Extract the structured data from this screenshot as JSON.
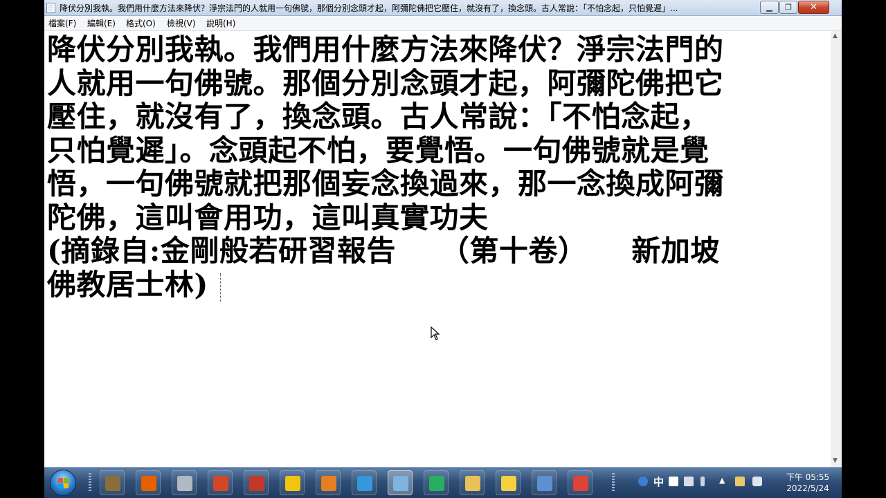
{
  "window": {
    "title": "降伏分別我執。我們用什麼方法來降伏？淨宗法門的人就用一句佛號，那個分別念頭才起，阿彌陀佛把它壓住，就沒有了，換念頭。古人常說：「不怕念起，只怕覺遲」...",
    "min_label": "▁",
    "max_label": "❐",
    "close_label": "✕"
  },
  "menu": {
    "items": [
      "檔案(F)",
      "編輯(E)",
      "格式(O)",
      "檢視(V)",
      "說明(H)"
    ]
  },
  "document": {
    "lines": [
      "降伏分別我執。我們用什麼方法來降伏？淨宗法門的",
      "人就用一句佛號。那個分別念頭才起，阿彌陀佛把它",
      "壓住，就沒有了，換念頭。古人常說：「不怕念起，",
      "只怕覺遲」。念頭起不怕，要覺悟。一句佛號就是覺",
      "悟，一句佛號就把那個妄念換過來，那一念換成阿彌",
      "陀佛，這叫會用功，這叫真實功夫",
      "(摘錄自:金剛般若研習報告　　（第十卷）　　新加坡",
      "佛教居士林)"
    ]
  },
  "taskbar": {
    "apps": [
      {
        "name": "jurassic-icon",
        "color": "#8a6d3b"
      },
      {
        "name": "firefox-icon",
        "color": "#e66000"
      },
      {
        "name": "camera-icon",
        "color": "#b0b8c4"
      },
      {
        "name": "powerpoint-icon",
        "color": "#d24726"
      },
      {
        "name": "pdf-icon",
        "color": "#c0392b"
      },
      {
        "name": "terminal-icon",
        "color": "#f1c40f"
      },
      {
        "name": "photo-icon",
        "color": "#e67e22"
      },
      {
        "name": "network-icon",
        "color": "#3498db"
      },
      {
        "name": "notepad-icon",
        "color": "#7fb3e0"
      },
      {
        "name": "refresh-icon",
        "color": "#27ae60"
      },
      {
        "name": "folder-icon",
        "color": "#e8c15a"
      },
      {
        "name": "emoji-icon",
        "color": "#f4d03f"
      },
      {
        "name": "wordpad-icon",
        "color": "#5d8fd1"
      },
      {
        "name": "chrome-icon",
        "color": "#db4437"
      }
    ]
  },
  "tray": {
    "language": "中",
    "clock_period_time": "下午 05:55",
    "clock_date": "2022/5/24",
    "show_hidden_label": "▲"
  }
}
